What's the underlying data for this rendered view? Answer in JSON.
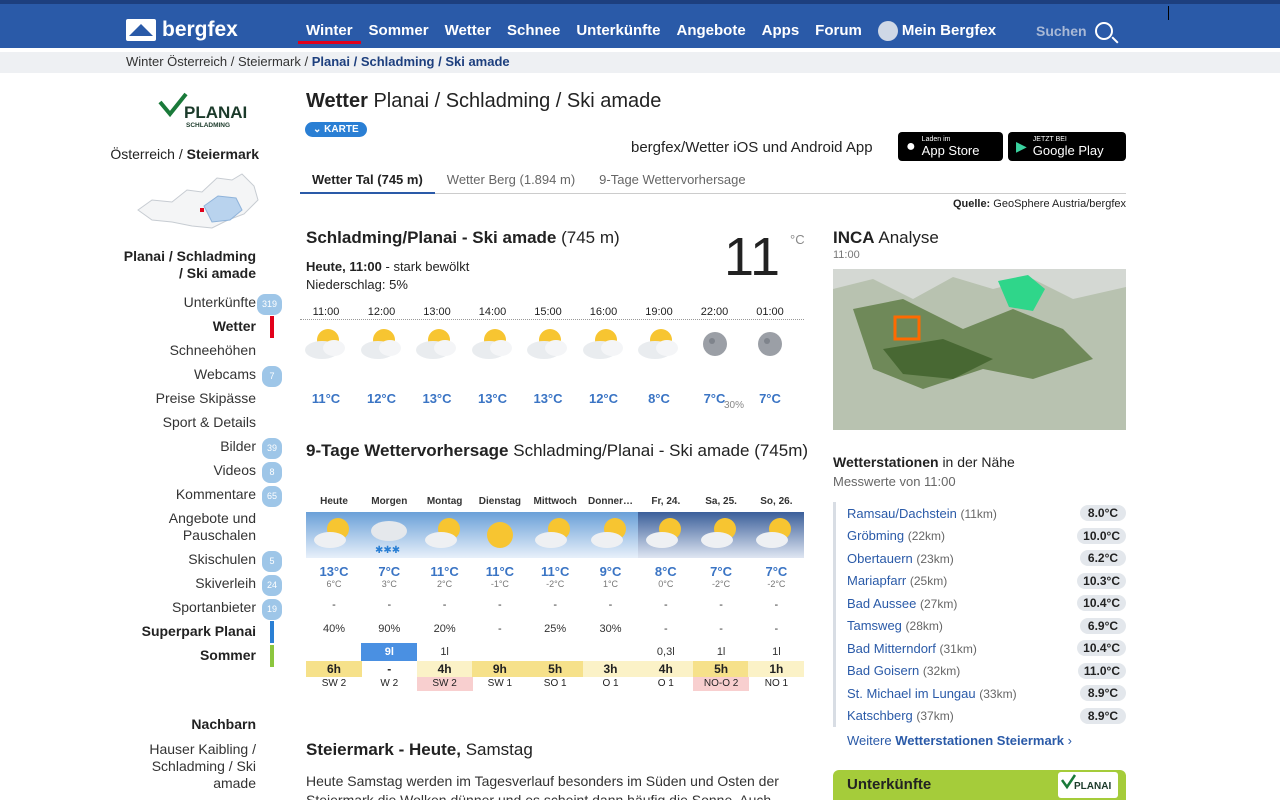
{
  "header": {
    "logo": "bergfex",
    "nav": [
      "Winter",
      "Sommer",
      "Wetter",
      "Schnee",
      "Unterkünfte",
      "Angebote",
      "Apps",
      "Forum",
      "Mein Bergfex"
    ],
    "search": "Suchen"
  },
  "breadcrumb": {
    "a": "Winter Österreich",
    "b": "Steiermark",
    "c": "Planai / Schladming / Ski amade"
  },
  "sidebar": {
    "logo_text": "PLANAI",
    "logo_sub": "SCHLADMING",
    "region_a": "Österreich",
    "region_b": "Steiermark",
    "resort_a": "Planai / Schladming",
    "resort_b": "/ Ski amade",
    "items": [
      {
        "label": "Unterkünfte",
        "badge": "319"
      },
      {
        "label": "Wetter",
        "badge": ""
      },
      {
        "label": "Schneehöhen",
        "badge": ""
      },
      {
        "label": "Webcams",
        "badge": "7"
      },
      {
        "label": "Preise Skipässe",
        "badge": ""
      },
      {
        "label": "Sport & Details",
        "badge": ""
      },
      {
        "label": "Bilder",
        "badge": "39"
      },
      {
        "label": "Videos",
        "badge": "8"
      },
      {
        "label": "Kommentare",
        "badge": "65"
      },
      {
        "label": "Angebote und Pauschalen",
        "badge": ""
      },
      {
        "label": "Skischulen",
        "badge": "5"
      },
      {
        "label": "Skiverleih",
        "badge": "24"
      },
      {
        "label": "Sportanbieter",
        "badge": "19"
      },
      {
        "label": "Superpark Planai",
        "badge": ""
      },
      {
        "label": "Sommer",
        "badge": ""
      }
    ],
    "neighbors_title": "Nachbarn",
    "neighbor_1": "Hauser Kaibling / Schladming / Ski amade"
  },
  "main": {
    "title_bold": "Wetter",
    "title_rest": "Planai / Schladming / Ski amade",
    "karte": "KARTE",
    "app_text": "bergfex/Wetter iOS und Android App",
    "appstore_small": "Laden im",
    "appstore": "App Store",
    "googleplay_small": "JETZT BEI",
    "googleplay": "Google Play",
    "tabs": [
      "Wetter Tal (745 m)",
      "Wetter Berg (1.894 m)",
      "9-Tage Wettervorhersage"
    ],
    "source_label": "Quelle:",
    "source": "GeoSphere Austria/bergfex",
    "loc_bold": "Schladming/Planai - Ski amade",
    "loc_alt": "(745 m)",
    "temp": "11",
    "unit": "°C",
    "now_bold": "Heute, 11:00",
    "now_rest": "- stark bewölkt",
    "precip": "Niederschlag: 5%",
    "hourly": [
      {
        "time": "11:00",
        "temp": "11°C",
        "icon": "partly-cloudy-sun"
      },
      {
        "time": "12:00",
        "temp": "12°C",
        "icon": "partly-cloudy-sun"
      },
      {
        "time": "13:00",
        "temp": "13°C",
        "icon": "partly-cloudy-sun"
      },
      {
        "time": "14:00",
        "temp": "13°C",
        "icon": "partly-cloudy-sun"
      },
      {
        "time": "15:00",
        "temp": "13°C",
        "icon": "partly-cloudy-sun"
      },
      {
        "time": "16:00",
        "temp": "12°C",
        "icon": "partly-cloudy-sun"
      },
      {
        "time": "19:00",
        "temp": "8°C",
        "icon": "partly-cloudy-sun"
      },
      {
        "time": "22:00",
        "temp": "7°C",
        "icon": "moon"
      },
      {
        "time": "01:00",
        "temp": "7°C",
        "icon": "moon"
      }
    ],
    "hourly_extra": "30%",
    "forecast_title_bold": "9-Tage Wettervorhersage",
    "forecast_title_rest": "Schladming/Planai - Ski amade (745m)",
    "forecast": [
      {
        "day": "Heute",
        "hi": "13°C",
        "lo": "6°C",
        "r1": "-",
        "r2": "40%",
        "snow": "",
        "sun": "6h",
        "wind": "SW 2"
      },
      {
        "day": "Morgen",
        "hi": "7°C",
        "lo": "3°C",
        "r1": "-",
        "r2": "90%",
        "snow": "9l",
        "sun": "-",
        "wind": "W 2"
      },
      {
        "day": "Montag",
        "hi": "11°C",
        "lo": "2°C",
        "r1": "-",
        "r2": "20%",
        "snow": "1l",
        "sun": "4h",
        "wind": "SW 2"
      },
      {
        "day": "Dienstag",
        "hi": "11°C",
        "lo": "-1°C",
        "r1": "-",
        "r2": "-",
        "snow": "",
        "sun": "9h",
        "wind": "SW 1"
      },
      {
        "day": "Mittwoch",
        "hi": "11°C",
        "lo": "-2°C",
        "r1": "-",
        "r2": "25%",
        "snow": "",
        "sun": "5h",
        "wind": "SO 1"
      },
      {
        "day": "Donner…",
        "hi": "9°C",
        "lo": "1°C",
        "r1": "-",
        "r2": "30%",
        "snow": "",
        "sun": "3h",
        "wind": "O 1"
      },
      {
        "day": "Fr, 24.",
        "hi": "8°C",
        "lo": "0°C",
        "r1": "-",
        "r2": "-",
        "snow": "0,3l",
        "sun": "4h",
        "wind": "O 1"
      },
      {
        "day": "Sa, 25.",
        "hi": "7°C",
        "lo": "-2°C",
        "r1": "-",
        "r2": "-",
        "snow": "1l",
        "sun": "5h",
        "wind": "NO-O 2"
      },
      {
        "day": "So, 26.",
        "hi": "7°C",
        "lo": "-2°C",
        "r1": "-",
        "r2": "-",
        "snow": "1l",
        "sun": "1h",
        "wind": "NO 1"
      }
    ],
    "st_title_bold": "Steiermark - Heute,",
    "st_title_rest": "Samstag",
    "st_text": "Heute Samstag werden im Tagesverlauf besonders im Süden und Osten der Steiermark die Wolken dünner und es scheint dann häufig die Sonne. Auch"
  },
  "right": {
    "inca_bold": "INCA",
    "inca_rest": "Analyse",
    "inca_time": "11:00",
    "ws_bold": "Wetterstationen",
    "ws_rest": "in der Nähe",
    "ws_sub": "Messwerte von 11:00",
    "stations": [
      {
        "name": "Ramsau/Dachstein",
        "dist": "(11km)",
        "temp": "8.0°C"
      },
      {
        "name": "Gröbming",
        "dist": "(22km)",
        "temp": "10.0°C"
      },
      {
        "name": "Obertauern",
        "dist": "(23km)",
        "temp": "6.2°C"
      },
      {
        "name": "Mariapfarr",
        "dist": "(25km)",
        "temp": "10.3°C"
      },
      {
        "name": "Bad Aussee",
        "dist": "(27km)",
        "temp": "10.4°C"
      },
      {
        "name": "Tamsweg",
        "dist": "(28km)",
        "temp": "6.9°C"
      },
      {
        "name": "Bad Mitterndorf",
        "dist": "(31km)",
        "temp": "10.4°C"
      },
      {
        "name": "Bad Goisern",
        "dist": "(32km)",
        "temp": "11.0°C"
      },
      {
        "name": "St. Michael im Lungau",
        "dist": "(33km)",
        "temp": "8.9°C"
      },
      {
        "name": "Katschberg",
        "dist": "(37km)",
        "temp": "8.9°C"
      }
    ],
    "more_a": "Weitere",
    "more_b": "Wetterstationen Steiermark",
    "unterk_a": "Unterkünfte",
    "unterk_logo": "PLANAI"
  },
  "colors": {
    "brand": "#2a5aa8",
    "accent": "#e2001a",
    "temp_blue": "#3a74c4",
    "superpark": "#2a7fd4",
    "sommer": "#8cc63e"
  }
}
